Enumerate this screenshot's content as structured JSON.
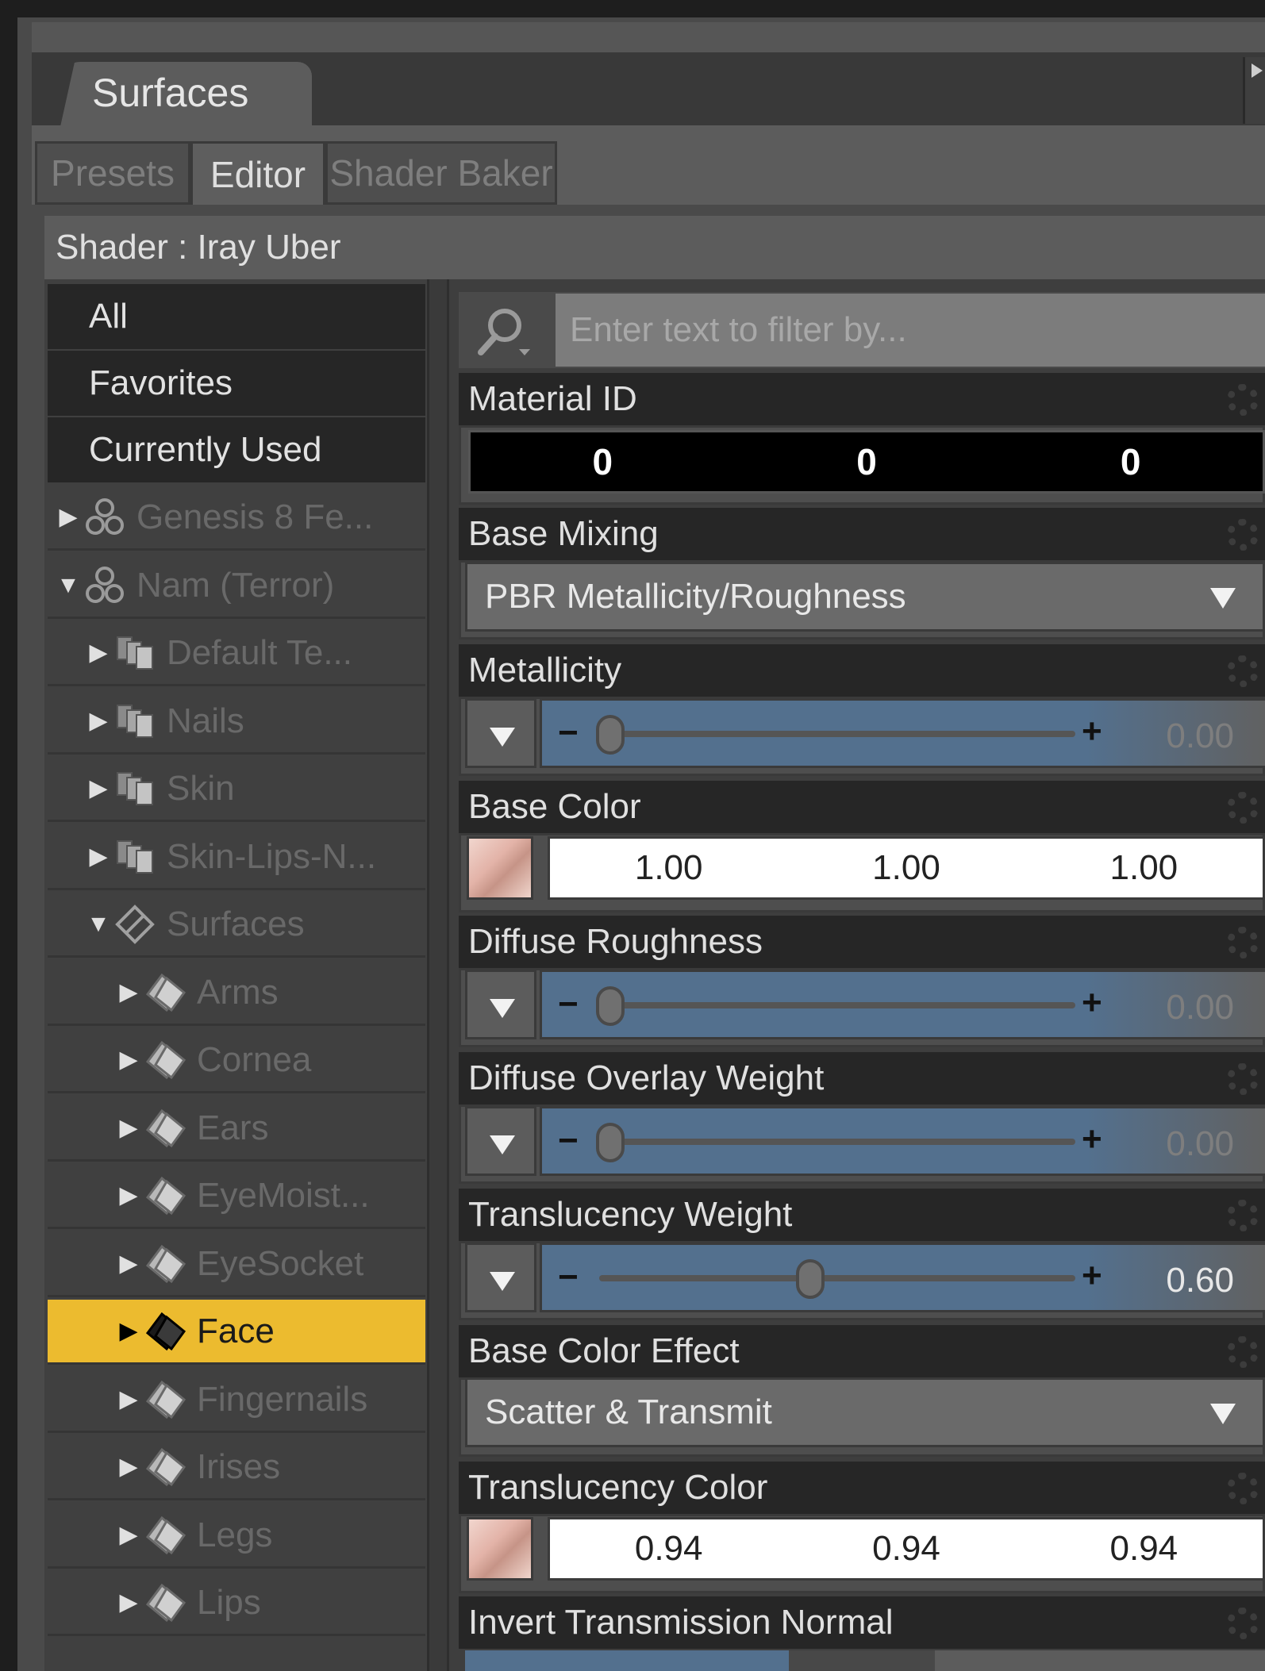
{
  "panel": {
    "title": "Surfaces"
  },
  "subtabs": [
    {
      "label": "Presets",
      "active": false
    },
    {
      "label": "Editor",
      "active": true
    },
    {
      "label": "Shader Baker",
      "active": false
    }
  ],
  "shader_label": "Shader : Iray Uber",
  "categories": [
    "All",
    "Favorites",
    "Currently Used"
  ],
  "tree": [
    {
      "label": "Genesis 8 Fe...",
      "arrow": "▶",
      "icon": "figure-icon",
      "expanded": false,
      "selected": false
    },
    {
      "label": "Nam (Terror)",
      "arrow": "▼",
      "icon": "figure-icon",
      "expanded": true,
      "selected": false
    },
    {
      "label": "Default Te...",
      "arrow": "▶",
      "icon": "material-group-icon",
      "expanded": false,
      "selected": false
    },
    {
      "label": "Nails",
      "arrow": "▶",
      "icon": "material-group-icon",
      "expanded": false,
      "selected": false
    },
    {
      "label": "Skin",
      "arrow": "▶",
      "icon": "material-group-icon",
      "expanded": false,
      "selected": false
    },
    {
      "label": "Skin-Lips-N...",
      "arrow": "▶",
      "icon": "material-group-icon",
      "expanded": false,
      "selected": false
    },
    {
      "label": "Surfaces",
      "arrow": "▼",
      "icon": "surfaces-icon",
      "expanded": true,
      "selected": false
    },
    {
      "label": "Arms",
      "arrow": "▶",
      "icon": "surface-icon",
      "expanded": false,
      "selected": false
    },
    {
      "label": "Cornea",
      "arrow": "▶",
      "icon": "surface-icon",
      "expanded": false,
      "selected": false
    },
    {
      "label": "Ears",
      "arrow": "▶",
      "icon": "surface-icon",
      "expanded": false,
      "selected": false
    },
    {
      "label": "EyeMoist...",
      "arrow": "▶",
      "icon": "surface-icon",
      "expanded": false,
      "selected": false
    },
    {
      "label": "EyeSocket",
      "arrow": "▶",
      "icon": "surface-icon",
      "expanded": false,
      "selected": false
    },
    {
      "label": "Face",
      "arrow": "▶",
      "icon": "surface-icon",
      "expanded": false,
      "selected": true
    },
    {
      "label": "Fingernails",
      "arrow": "▶",
      "icon": "surface-icon",
      "expanded": false,
      "selected": false
    },
    {
      "label": "Irises",
      "arrow": "▶",
      "icon": "surface-icon",
      "expanded": false,
      "selected": false
    },
    {
      "label": "Legs",
      "arrow": "▶",
      "icon": "surface-icon",
      "expanded": false,
      "selected": false
    },
    {
      "label": "Lips",
      "arrow": "▶",
      "icon": "surface-icon",
      "expanded": false,
      "selected": false
    }
  ],
  "filter": {
    "placeholder": "Enter text to filter by..."
  },
  "properties": {
    "material_id": {
      "label": "Material ID",
      "values": [
        "0",
        "0",
        "0"
      ]
    },
    "base_mixing": {
      "label": "Base Mixing",
      "value": "PBR Metallicity/Roughness"
    },
    "metallicity": {
      "label": "Metallicity",
      "value": "0.00",
      "level": 0.0
    },
    "base_color": {
      "label": "Base Color",
      "values": [
        "1.00",
        "1.00",
        "1.00"
      ]
    },
    "diffuse_roughness": {
      "label": "Diffuse Roughness",
      "value": "0.00",
      "level": 0.0
    },
    "diffuse_overlay_weight": {
      "label": "Diffuse Overlay Weight",
      "value": "0.00",
      "level": 0.0
    },
    "translucency_weight": {
      "label": "Translucency Weight",
      "value": "0.60",
      "level": 0.6
    },
    "base_color_effect": {
      "label": "Base Color Effect",
      "value": "Scatter & Transmit"
    },
    "translucency_color": {
      "label": "Translucency Color",
      "values": [
        "0.94",
        "0.94",
        "0.94"
      ]
    },
    "invert_transmission_normal": {
      "label": "Invert Transmission Normal"
    }
  },
  "colors": {
    "selection": "#ecbb2f",
    "slider_fill": "#53708e",
    "background": "#3e3e3e"
  }
}
